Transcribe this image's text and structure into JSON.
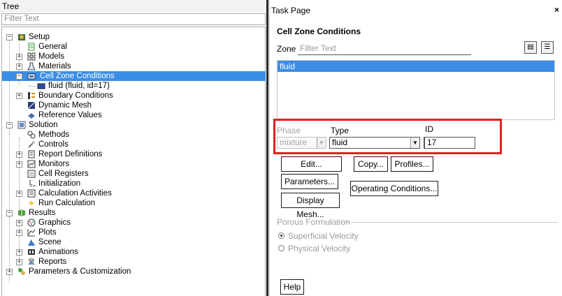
{
  "tree": {
    "title": "Tree",
    "filter_placeholder": "Filter Text",
    "nodes": [
      {
        "label": "Setup",
        "icon": "setup-icon"
      },
      {
        "label": "General",
        "icon": "general-icon"
      },
      {
        "label": "Models",
        "icon": "models-icon"
      },
      {
        "label": "Materials",
        "icon": "materials-icon"
      },
      {
        "label": "Cell Zone Conditions",
        "icon": "cell-zone-icon"
      },
      {
        "label": "fluid (fluid, id=17)",
        "icon": "fluid-zone-icon"
      },
      {
        "label": "Boundary Conditions",
        "icon": "boundary-icon"
      },
      {
        "label": "Dynamic Mesh",
        "icon": "dynamic-mesh-icon"
      },
      {
        "label": "Reference Values",
        "icon": "reference-values-icon"
      },
      {
        "label": "Solution",
        "icon": "solution-icon"
      },
      {
        "label": "Methods",
        "icon": "methods-icon"
      },
      {
        "label": "Controls",
        "icon": "controls-icon"
      },
      {
        "label": "Report Definitions",
        "icon": "report-definitions-icon"
      },
      {
        "label": "Monitors",
        "icon": "monitors-icon"
      },
      {
        "label": "Cell Registers",
        "icon": "cell-registers-icon"
      },
      {
        "label": "Initialization",
        "icon": "initialization-icon"
      },
      {
        "label": "Calculation Activities",
        "icon": "calculation-activities-icon"
      },
      {
        "label": "Run Calculation",
        "icon": "run-calculation-icon"
      },
      {
        "label": "Results",
        "icon": "results-icon"
      },
      {
        "label": "Graphics",
        "icon": "graphics-icon"
      },
      {
        "label": "Plots",
        "icon": "plots-icon"
      },
      {
        "label": "Scene",
        "icon": "scene-icon"
      },
      {
        "label": "Animations",
        "icon": "animations-icon"
      },
      {
        "label": "Reports",
        "icon": "reports-icon"
      },
      {
        "label": "Parameters & Customization",
        "icon": "parameters-icon"
      }
    ]
  },
  "task": {
    "title": "Task Page",
    "close": "×",
    "section_title": "Cell Zone Conditions",
    "zone_label": "Zone",
    "zone_filter_placeholder": "Filter Text",
    "zones": [
      "fluid"
    ],
    "phase_label": "Phase",
    "phase_value": "mixture",
    "type_label": "Type",
    "type_value": "fluid",
    "id_label": "ID",
    "id_value": "17",
    "buttons": {
      "edit": "Edit...",
      "copy": "Copy...",
      "profiles": "Profiles...",
      "parameters": "Parameters...",
      "operating_conditions": "Operating Conditions...",
      "display_mesh": "Display Mesh...",
      "help": "Help"
    },
    "porous_title": "Porous Formulation",
    "porous_options": [
      {
        "label": "Superficial Velocity",
        "selected": true
      },
      {
        "label": "Physical Velocity",
        "selected": false
      }
    ]
  },
  "colors": {
    "selection": "#3a8ee6",
    "highlight_box": "#e02020"
  }
}
